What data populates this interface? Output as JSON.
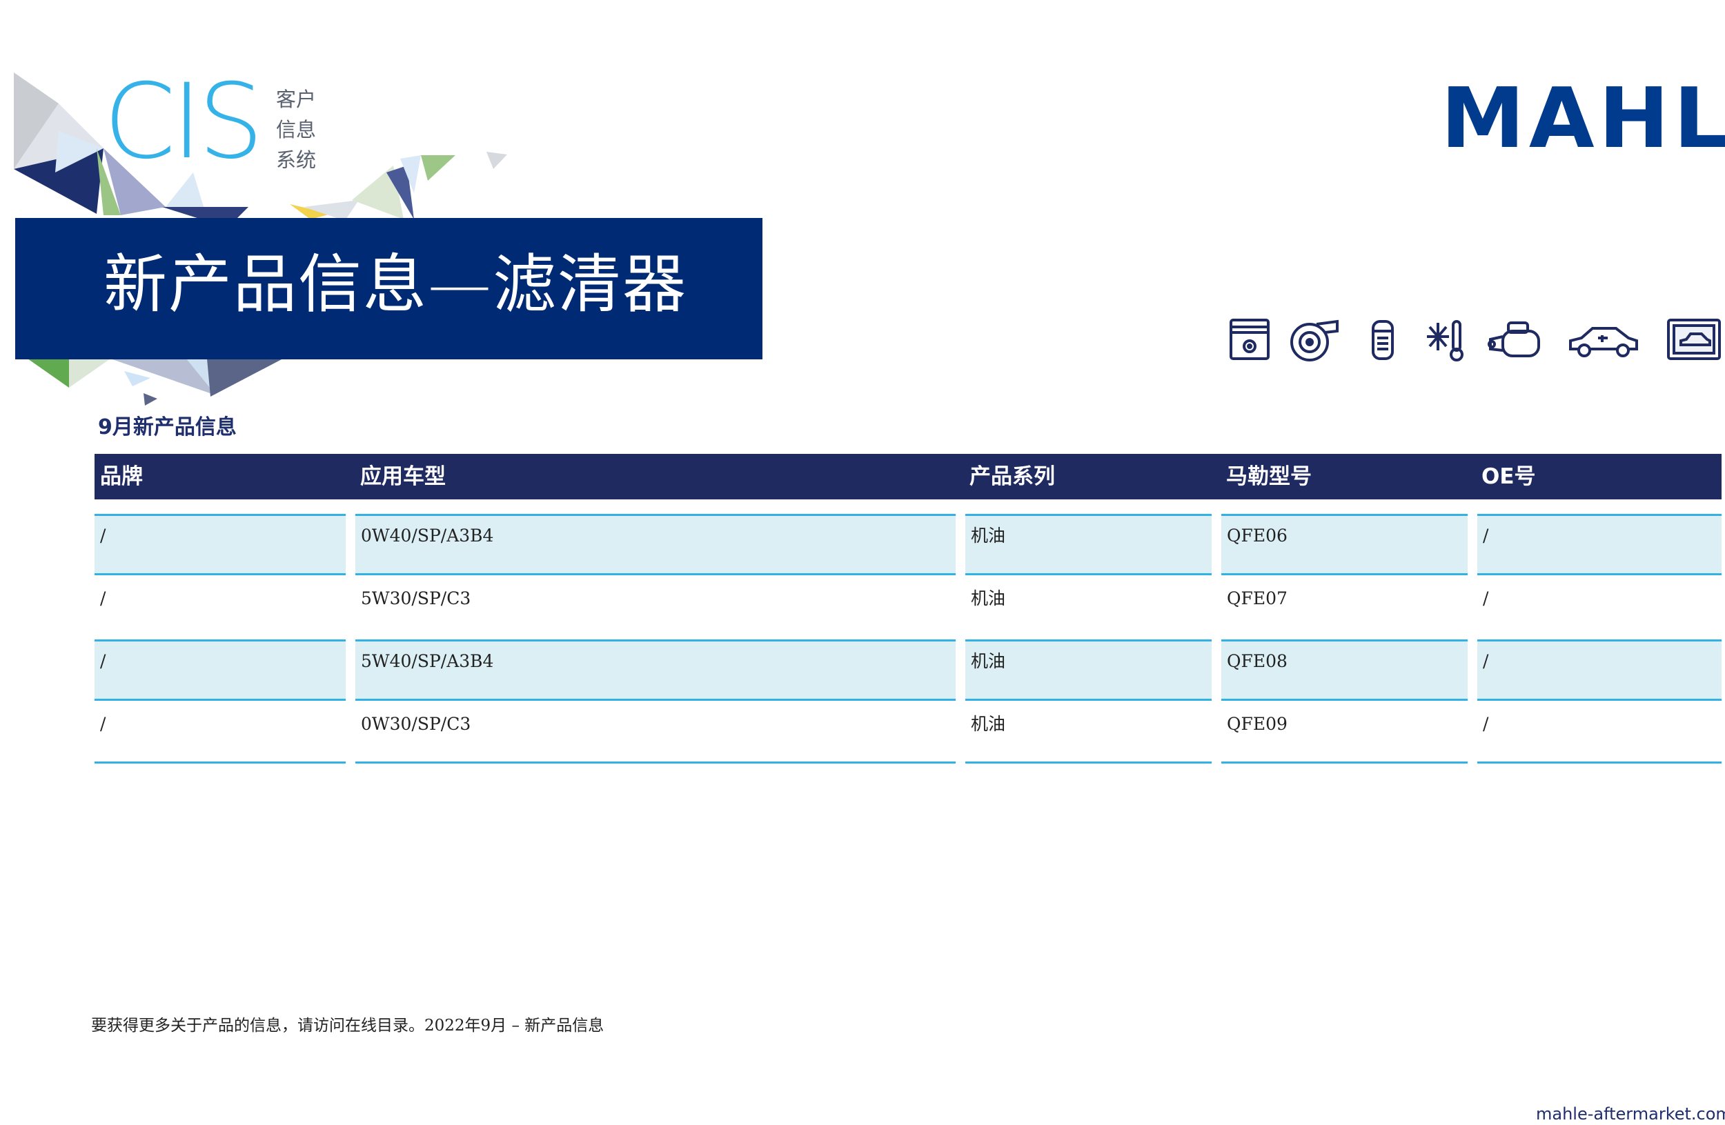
{
  "cis_logo": {
    "letters": "CIS",
    "sub_lines": [
      "客户",
      "信息",
      "系统"
    ]
  },
  "brand_logo": "MAHLE",
  "title": "新产品信息—滤清器",
  "product_icons": [
    "piston-icon",
    "turbocharger-icon",
    "oil-filter-icon",
    "thermal-management-icon",
    "starter-motor-icon",
    "electric-car-icon",
    "diagnostic-device-icon"
  ],
  "subtitle": "9月新产品信息",
  "table": {
    "headers": [
      "品牌",
      "应用车型",
      "产品系列",
      "马勒型号",
      "OE号"
    ],
    "rows": [
      [
        "/",
        "0W40/SP/A3B4",
        "机油",
        "QFE06",
        "/"
      ],
      [
        "/",
        "5W30/SP/C3",
        "机油",
        "QFE07",
        "/"
      ],
      [
        "/",
        "5W40/SP/A3B4",
        "机油",
        "QFE08",
        "/"
      ],
      [
        "/",
        "0W30/SP/C3",
        "机油",
        "QFE09",
        "/"
      ]
    ]
  },
  "footer_note": "要获得更多关于产品的信息，请访问在线目录。2022年9月 – 新产品信息",
  "site_url": "mahle-aftermarket.com",
  "colors": {
    "navy": "#002a74",
    "header_navy": "#1f2a60",
    "cyan": "#31b1e4",
    "row_shade": "#dbeff4",
    "mahle_blue": "#003b8e"
  }
}
